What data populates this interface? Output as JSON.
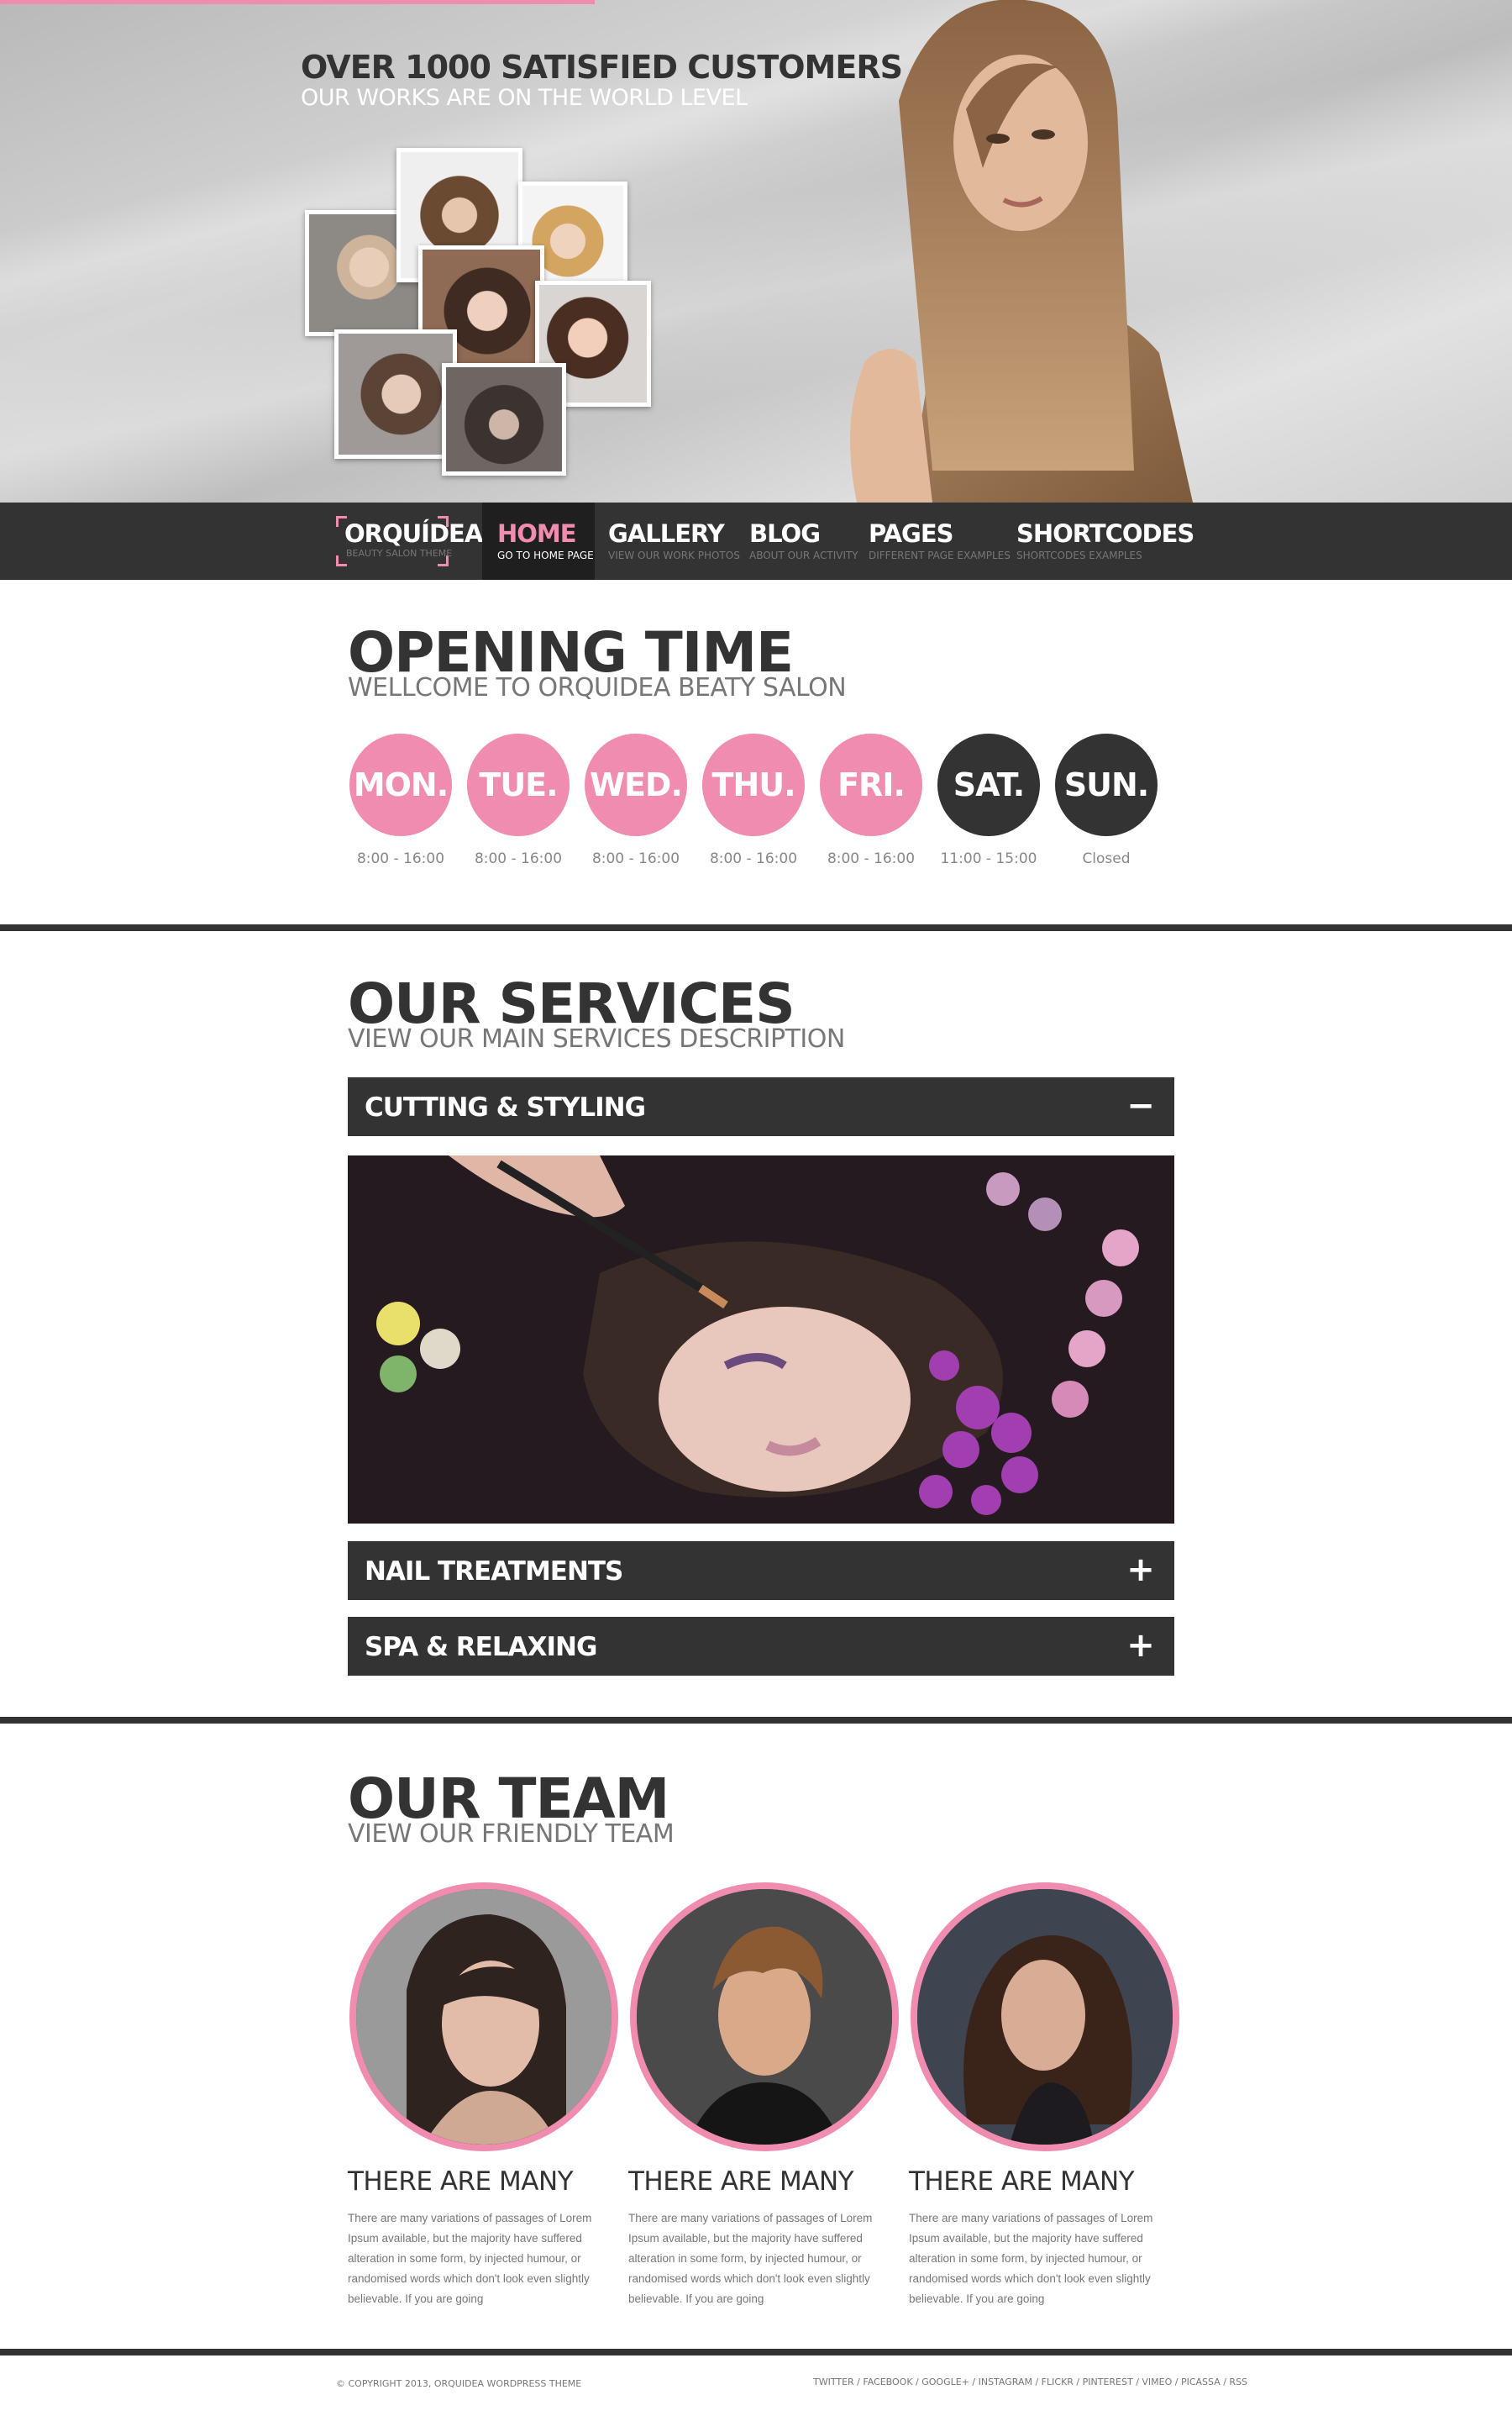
{
  "hero": {
    "title": "Over 1000 satisfied customers",
    "subtitle": "Our works are on the world level"
  },
  "nav": {
    "logo": {
      "name": "ORQUÍDEA",
      "tagline": "Beauty salon theme"
    },
    "items": [
      {
        "label": "Home",
        "sub": "Go to home page",
        "active": true
      },
      {
        "label": "Gallery",
        "sub": "View our work photos"
      },
      {
        "label": "Blog",
        "sub": "About our activity"
      },
      {
        "label": "Pages",
        "sub": "Different page examples"
      },
      {
        "label": "Shortcodes",
        "sub": "Shortcodes examples"
      }
    ]
  },
  "opening": {
    "title": "Opening time",
    "subtitle": "Wellcome to Orquidea Beaty Salon",
    "days": [
      {
        "day": "Mon.",
        "hours": "8:00 - 16:00"
      },
      {
        "day": "Tue.",
        "hours": "8:00 - 16:00"
      },
      {
        "day": "Wed.",
        "hours": "8:00 - 16:00"
      },
      {
        "day": "Thu.",
        "hours": "8:00 - 16:00"
      },
      {
        "day": "Fri.",
        "hours": "8:00 - 16:00"
      },
      {
        "day": "Sat.",
        "hours": "11:00 - 15:00"
      },
      {
        "day": "Sun.",
        "hours": "Closed"
      }
    ]
  },
  "services": {
    "title": "Our services",
    "subtitle": "View our main services description",
    "items": [
      {
        "label": "Cutting & Styling",
        "icon": "−"
      },
      {
        "label": "Nail treatments",
        "icon": "+"
      },
      {
        "label": "Spa & Relaxing",
        "icon": "+"
      }
    ]
  },
  "team": {
    "title": "Our team",
    "subtitle": "View our friendly team",
    "members": [
      {
        "name": "There are many",
        "text": "There are many variations of passages of Lorem Ipsum available, but the majority have suffered alteration in some form, by injected humour, or randomised words which don't look even slightly believable. If you are going"
      },
      {
        "name": "There are many",
        "text": "There are many variations of passages of Lorem Ipsum available, but the majority have suffered alteration in some form, by injected humour, or randomised words which don't look even slightly believable. If you are going"
      },
      {
        "name": "There are many",
        "text": "There are many variations of passages of Lorem Ipsum available, but the majority have suffered alteration in some form, by injected humour, or randomised words which don't look even slightly believable. If you are going"
      }
    ]
  },
  "footer": {
    "copyright": "© Copyright 2013, Orquidea Wordpress Theme",
    "social": "Twitter / Facebook / Google+ / Instagram / Flickr / Pinterest / Vimeo / Picassa / RSS"
  },
  "colors": {
    "accent": "#ef8cb0",
    "dark": "#333333"
  }
}
